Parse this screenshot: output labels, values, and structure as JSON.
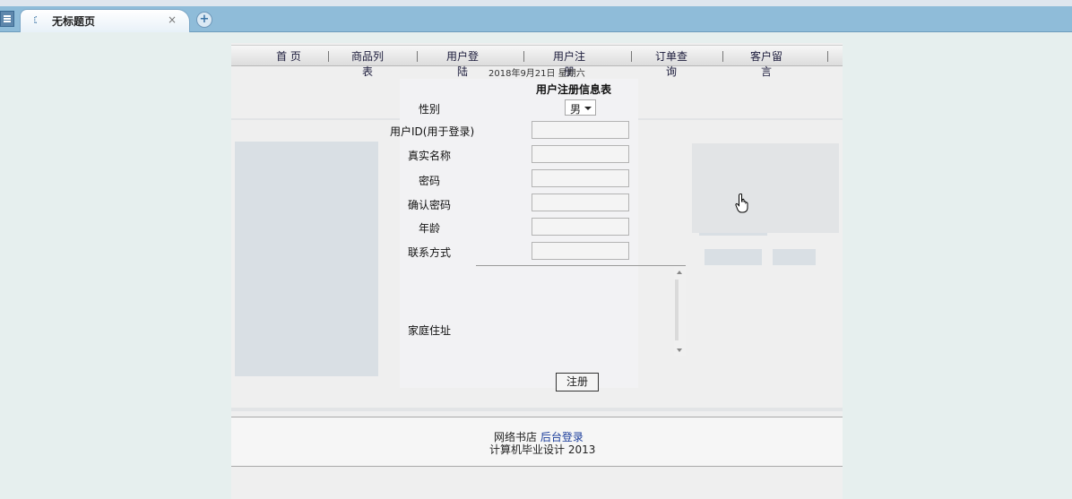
{
  "tab": {
    "title": "无标题页",
    "close": "×",
    "new_tab": "+"
  },
  "nav": {
    "items": [
      "首 页",
      "商品列表",
      "用户登陆",
      "用户注册",
      "订单查询",
      "客户留言"
    ]
  },
  "date": "2018年9月21日  星期六",
  "form": {
    "title": "用户注册信息表",
    "gender_label": "性别",
    "gender_value": "男",
    "userid_label": "用户ID(用于登录)",
    "realname_label": "真实名称",
    "password_label": "密码",
    "confirm_label": "确认密码",
    "age_label": "年龄",
    "contact_label": "联系方式",
    "address_label": "家庭住址",
    "submit_label": "注册"
  },
  "footer": {
    "site_name": "网络书店",
    "admin_link": "后台登录",
    "credit": "计算机毕业设计  2013"
  }
}
